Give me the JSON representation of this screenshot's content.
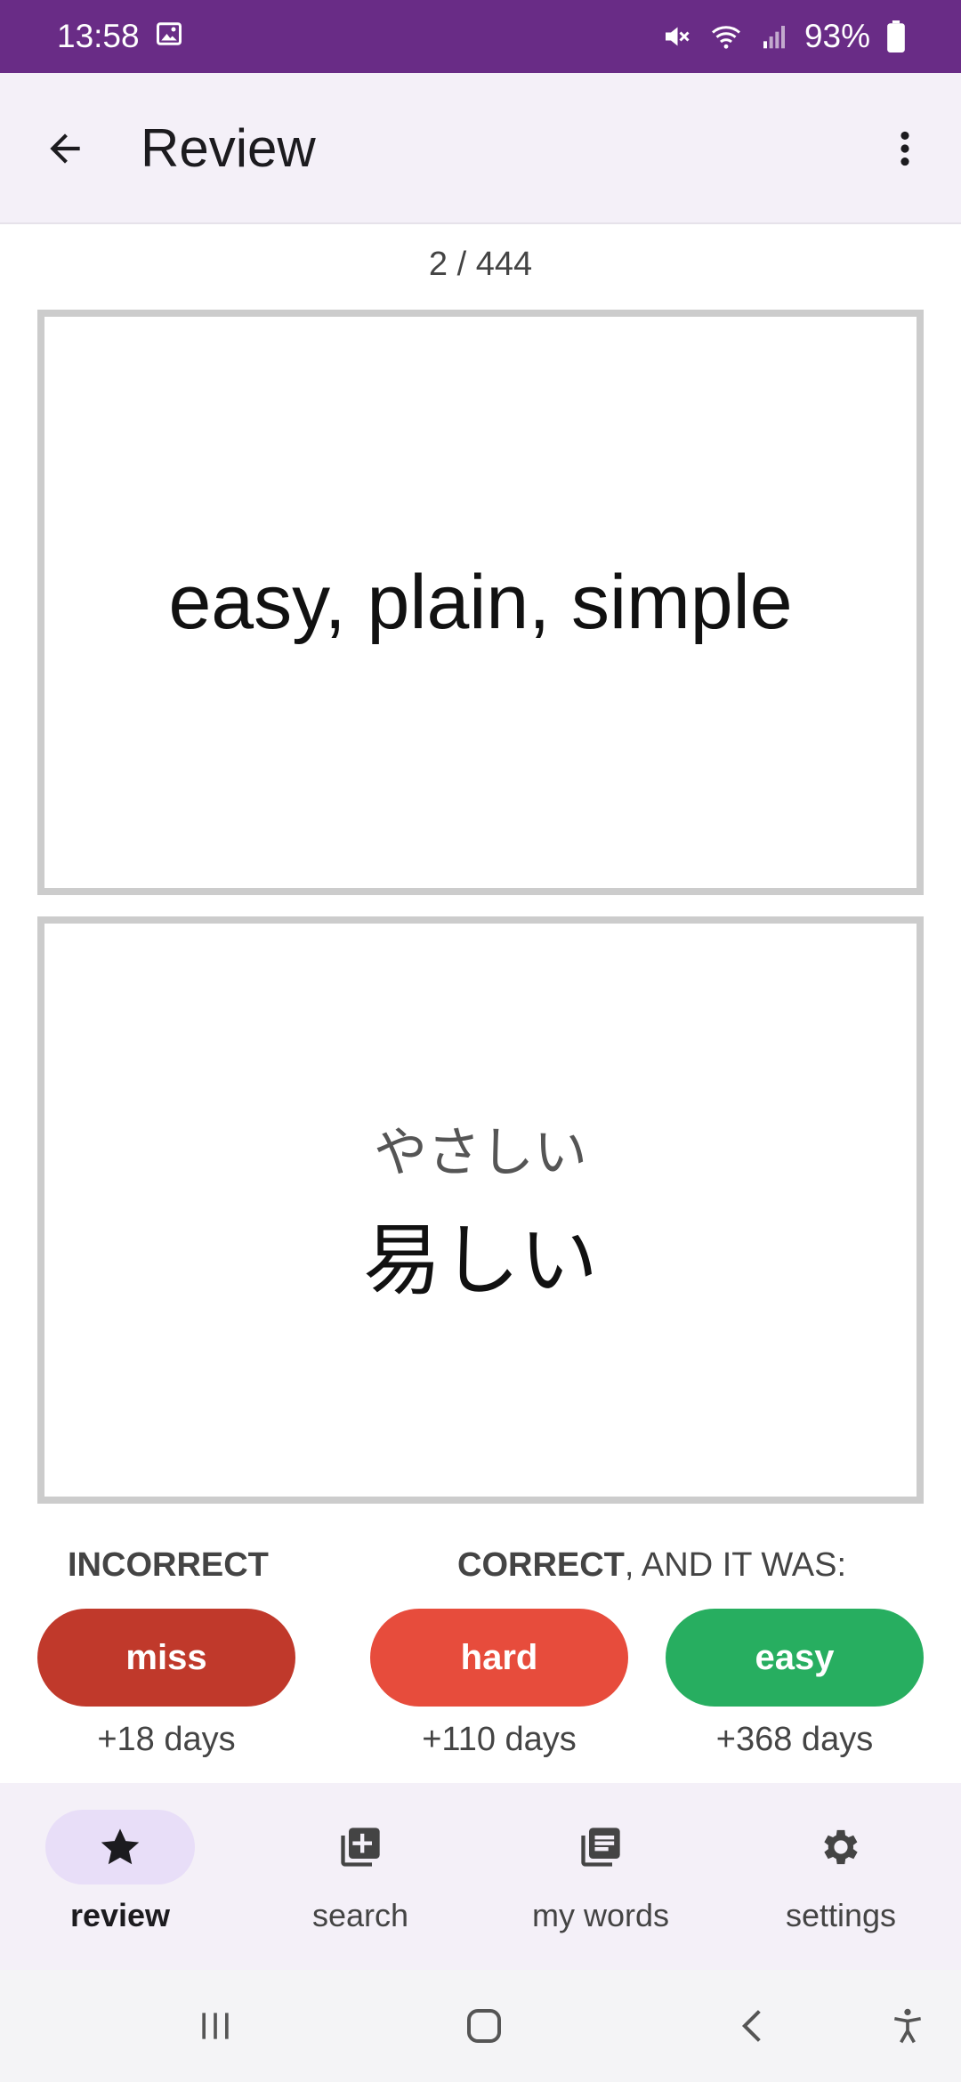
{
  "status_bar": {
    "time": "13:58",
    "battery": "93%",
    "icons": [
      "image-icon",
      "mute-icon",
      "wifi-icon",
      "signal-icon",
      "battery-icon"
    ]
  },
  "app_bar": {
    "title": "Review",
    "back_icon": "arrow-back-icon",
    "more_icon": "more-vert-icon"
  },
  "progress": "2 / 444",
  "card_front": {
    "meaning": "easy, plain, simple"
  },
  "card_back": {
    "reading": "やさしい",
    "kanji": "易しい"
  },
  "answers": {
    "incorrect_label": "INCORRECT",
    "correct_label_bold": "CORRECT",
    "correct_label_rest": ", AND IT WAS:",
    "buttons": [
      {
        "label": "miss",
        "interval": "+18 days",
        "color": "#c0392b"
      },
      {
        "label": "hard",
        "interval": "+110 days",
        "color": "#e74c3c"
      },
      {
        "label": "easy",
        "interval": "+368 days",
        "color": "#27ae60"
      }
    ]
  },
  "bottom_nav": {
    "items": [
      {
        "label": "review",
        "icon": "star-icon",
        "active": true
      },
      {
        "label": "search",
        "icon": "add-library-icon",
        "active": false
      },
      {
        "label": "my words",
        "icon": "library-books-icon",
        "active": false
      },
      {
        "label": "settings",
        "icon": "gear-icon",
        "active": false
      }
    ]
  },
  "colors": {
    "status_bar": "#692c86",
    "app_bar": "#f4f0f8",
    "active_pill": "#e8def8",
    "card_border": "#cccccc"
  }
}
